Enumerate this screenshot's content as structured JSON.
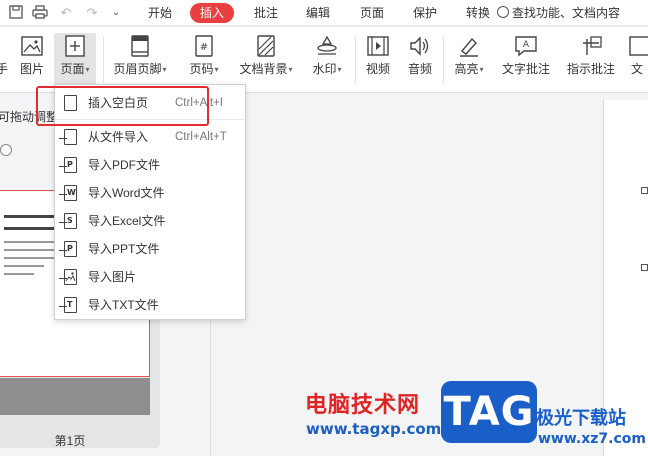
{
  "menubar": {
    "tabs": [
      {
        "label": "开始",
        "active": false
      },
      {
        "label": "插入",
        "active": true
      },
      {
        "label": "批注",
        "active": false
      },
      {
        "label": "编辑",
        "active": false
      },
      {
        "label": "页面",
        "active": false
      },
      {
        "label": "保护",
        "active": false
      },
      {
        "label": "转换",
        "active": false
      }
    ],
    "search_placeholder": "查找功能、文档内容",
    "accent_color": "#e84040"
  },
  "ribbon": {
    "items": [
      {
        "label": "手",
        "icon": "hand-icon",
        "has_arrow": false
      },
      {
        "label": "图片",
        "icon": "picture-icon",
        "has_arrow": false
      },
      {
        "label": "页面",
        "icon": "add-page-icon",
        "has_arrow": true,
        "pressed": true
      },
      {
        "label": "页眉页脚",
        "icon": "header-footer-icon",
        "has_arrow": true
      },
      {
        "label": "页码",
        "icon": "page-number-icon",
        "has_arrow": true
      },
      {
        "label": "文档背景",
        "icon": "background-icon",
        "has_arrow": true
      },
      {
        "label": "水印",
        "icon": "watermark-icon",
        "has_arrow": true
      },
      {
        "label": "视频",
        "icon": "video-icon",
        "has_arrow": false
      },
      {
        "label": "音频",
        "icon": "audio-icon",
        "has_arrow": false
      },
      {
        "label": "高亮",
        "icon": "highlight-icon",
        "has_arrow": true
      },
      {
        "label": "文字批注",
        "icon": "text-comment-icon",
        "has_arrow": false
      },
      {
        "label": "指示批注",
        "icon": "pointer-comment-icon",
        "has_arrow": false
      },
      {
        "label": "文",
        "icon": "text-icon",
        "has_arrow": false
      }
    ]
  },
  "left_panel": {
    "title": "可拖动调整",
    "page_label": "第1页"
  },
  "dropdown": {
    "items": [
      {
        "label": "插入空白页",
        "shortcut": "Ctrl+Alt+I",
        "icon": "blank-page-icon",
        "glyph": ""
      },
      {
        "label": "从文件导入",
        "shortcut": "Ctrl+Alt+T",
        "icon": "import-file-icon",
        "glyph": ""
      },
      {
        "label": "导入PDF文件",
        "shortcut": "",
        "icon": "pdf-file-icon",
        "glyph": "P"
      },
      {
        "label": "导入Word文件",
        "shortcut": "",
        "icon": "word-file-icon",
        "glyph": "W"
      },
      {
        "label": "导入Excel文件",
        "shortcut": "",
        "icon": "excel-file-icon",
        "glyph": "S"
      },
      {
        "label": "导入PPT文件",
        "shortcut": "",
        "icon": "ppt-file-icon",
        "glyph": "P"
      },
      {
        "label": "导入图片",
        "shortcut": "",
        "icon": "image-file-icon",
        "glyph": ""
      },
      {
        "label": "导入TXT文件",
        "shortcut": "",
        "icon": "txt-file-icon",
        "glyph": "T"
      }
    ],
    "highlight_color": "#e02e2e"
  },
  "watermark": {
    "brand_text": "电脑技术网",
    "brand_url": "www.tagxp.com",
    "logo_text": "TAG",
    "site_text": "极光下载站",
    "site_url": "www.xz7.com"
  }
}
